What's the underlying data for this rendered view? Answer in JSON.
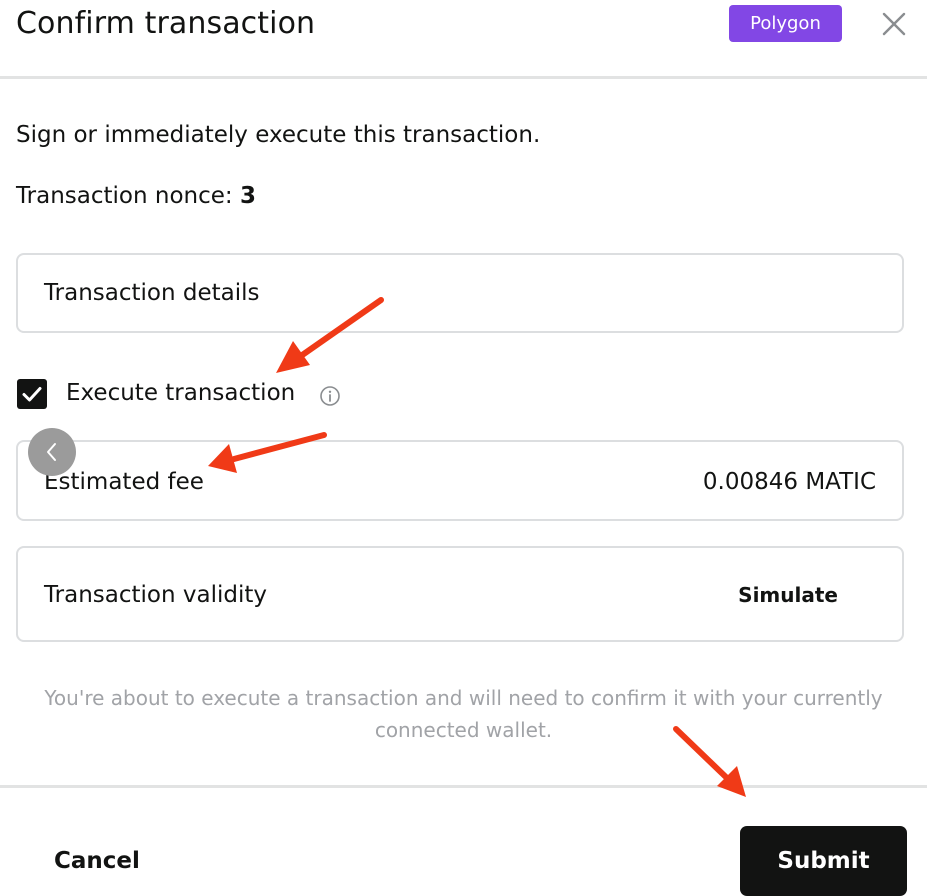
{
  "dialog": {
    "title": "Confirm transaction",
    "chain_badge": "Polygon",
    "subtitle": "Sign or immediately execute this transaction.",
    "nonce_label": "Transaction nonce: ",
    "nonce_value": "3"
  },
  "details": {
    "label": "Transaction details"
  },
  "execute": {
    "label": "Execute transaction",
    "checked": true
  },
  "fee": {
    "label": "Estimated fee",
    "value": "0.00846 MATIC"
  },
  "validity": {
    "label": "Transaction validity",
    "action": "Simulate"
  },
  "note": "You're about to execute a transaction and will need to confirm it with your currently connected wallet.",
  "footer": {
    "cancel_label": "Cancel",
    "submit_label": "Submit"
  },
  "icons": {
    "close": "close-icon",
    "checkbox": "checkmark-icon",
    "info": "info-icon",
    "back": "chevron-left-icon",
    "annotation": "red-arrow-icon"
  },
  "colors": {
    "accent_polygon": "#8247e5",
    "primary_button": "#121312",
    "annotation_arrow": "#f03a17",
    "muted_text": "#a1a3a7"
  }
}
